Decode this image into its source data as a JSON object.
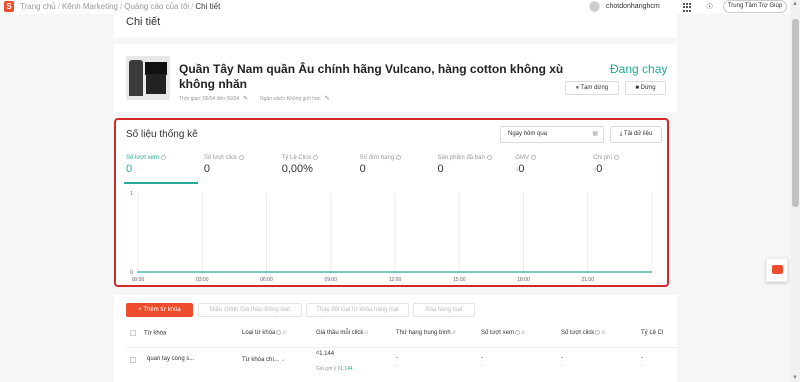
{
  "topbar": {
    "logo_letter": "S",
    "breadcrumb": [
      "Trang chủ",
      "Kênh Marketing",
      "Quảng cáo của tôi",
      "Chi tiết"
    ],
    "account_name": "chotdonhanghcm",
    "help_label": "Trung Tâm Trợ Giúp"
  },
  "page": {
    "title": "Chi tiết"
  },
  "product": {
    "title": "Quần Tây Nam quần Âu chính hãng Vulcano, hàng cotton không xù không nhăn",
    "time_label": "Thời gian: 05/04 đến 06/04",
    "budget_label": "Ngân sách: Không giới hạn",
    "status": "Đang chạy",
    "pause_label": "⏸ Tạm dừng",
    "stop_label": "■ Dừng"
  },
  "stats": {
    "title": "Số liệu thống kê",
    "date_range": "Ngày hôm qua",
    "download_label": "⤓ Tải dữ liệu",
    "metrics": [
      {
        "label": "Số lượt xem",
        "value": "0"
      },
      {
        "label": "Số lượt click",
        "value": "0"
      },
      {
        "label": "Tỷ Lệ Click",
        "value": "0,00%"
      },
      {
        "label": "Số đơn hàng",
        "value": "0"
      },
      {
        "label": "Sản phẩm đã bán",
        "value": "0"
      },
      {
        "label": "GMV",
        "currency": "₫",
        "value": "0"
      },
      {
        "label": "Chi phí",
        "currency": "₫",
        "value": "0"
      }
    ]
  },
  "chart_data": {
    "type": "line",
    "x": [
      "00:00",
      "03:00",
      "06:00",
      "09:00",
      "12:00",
      "15:00",
      "18:00",
      "21:00"
    ],
    "series": [
      {
        "values": [
          0,
          0,
          0,
          0,
          0,
          0,
          0,
          0
        ]
      }
    ],
    "yticks": [
      "1",
      "0"
    ],
    "ylim": [
      0,
      1
    ],
    "grid": true,
    "color": "#26aa99"
  },
  "table": {
    "add_label": "+ Thêm từ khóa",
    "bulk_bid_label": "Điều chỉnh Giá thầu Đồng loạt",
    "bulk_type_label": "Thay đổi loại từ khóa hàng loạt",
    "bulk_delete_label": "Xóa hàng loạt",
    "headers": [
      "Từ khóa",
      "Loại từ khóa",
      "Giá thầu mỗi click",
      "Thứ hạng trung bình",
      "Số lượt xem",
      "Số lượt click",
      "Tỷ Lệ Cl"
    ],
    "rows": [
      {
        "keyword": "quan tay cong s...",
        "type": "Từ khóa chí...",
        "bid": "₫1.144",
        "suggested_prefix": "Giá gợi ý ",
        "suggested_value": "₫1.144",
        "rank": "-",
        "views": "-",
        "clicks": "-",
        "ctr": "-"
      }
    ]
  }
}
